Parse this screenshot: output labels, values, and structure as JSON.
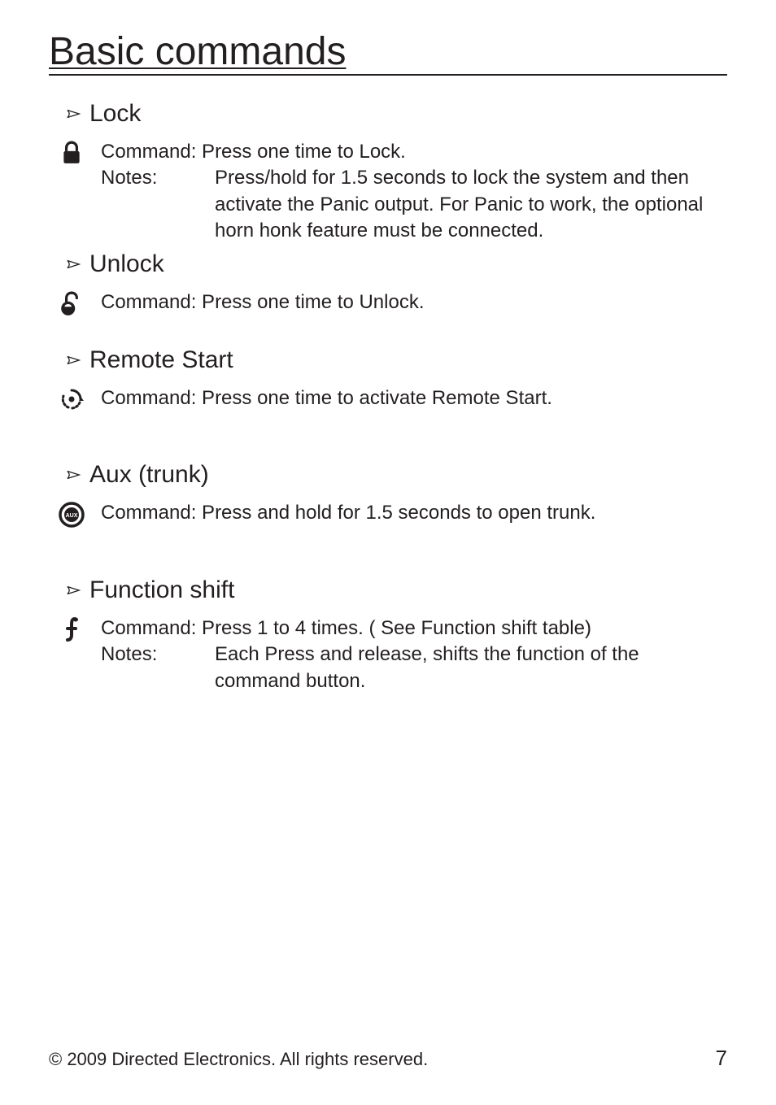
{
  "title": "Basic commands",
  "sections": {
    "lock": {
      "heading": "Lock",
      "command_label": "Command",
      "command_text": ": Press one time to Lock.",
      "notes_label": "Notes:",
      "notes_text": "Press/hold for 1.5 seconds to lock the system and then activate the Panic output. For Panic to work, the optional horn honk feature must be connected."
    },
    "unlock": {
      "heading": "Unlock",
      "command_label": "Command",
      "command_text": ": Press one time to Unlock."
    },
    "remote_start": {
      "heading": "Remote Start",
      "command_label": "Command",
      "command_text": ": Press one time to activate Remote Start."
    },
    "aux": {
      "heading": "Aux (trunk)",
      "command_label": "Command",
      "command_text": ": Press and hold for 1.5 seconds to open trunk."
    },
    "fshift": {
      "heading": "Function shift",
      "command_label": "Command",
      "command_text": ": Press 1 to 4 times. ( See Function shift table)",
      "notes_label": "Notes:",
      "notes_text": "Each Press and release, shifts the function of the command button."
    }
  },
  "footer": {
    "copyright": "© 2009 Directed Electronics. All rights reserved.",
    "page": "7"
  }
}
